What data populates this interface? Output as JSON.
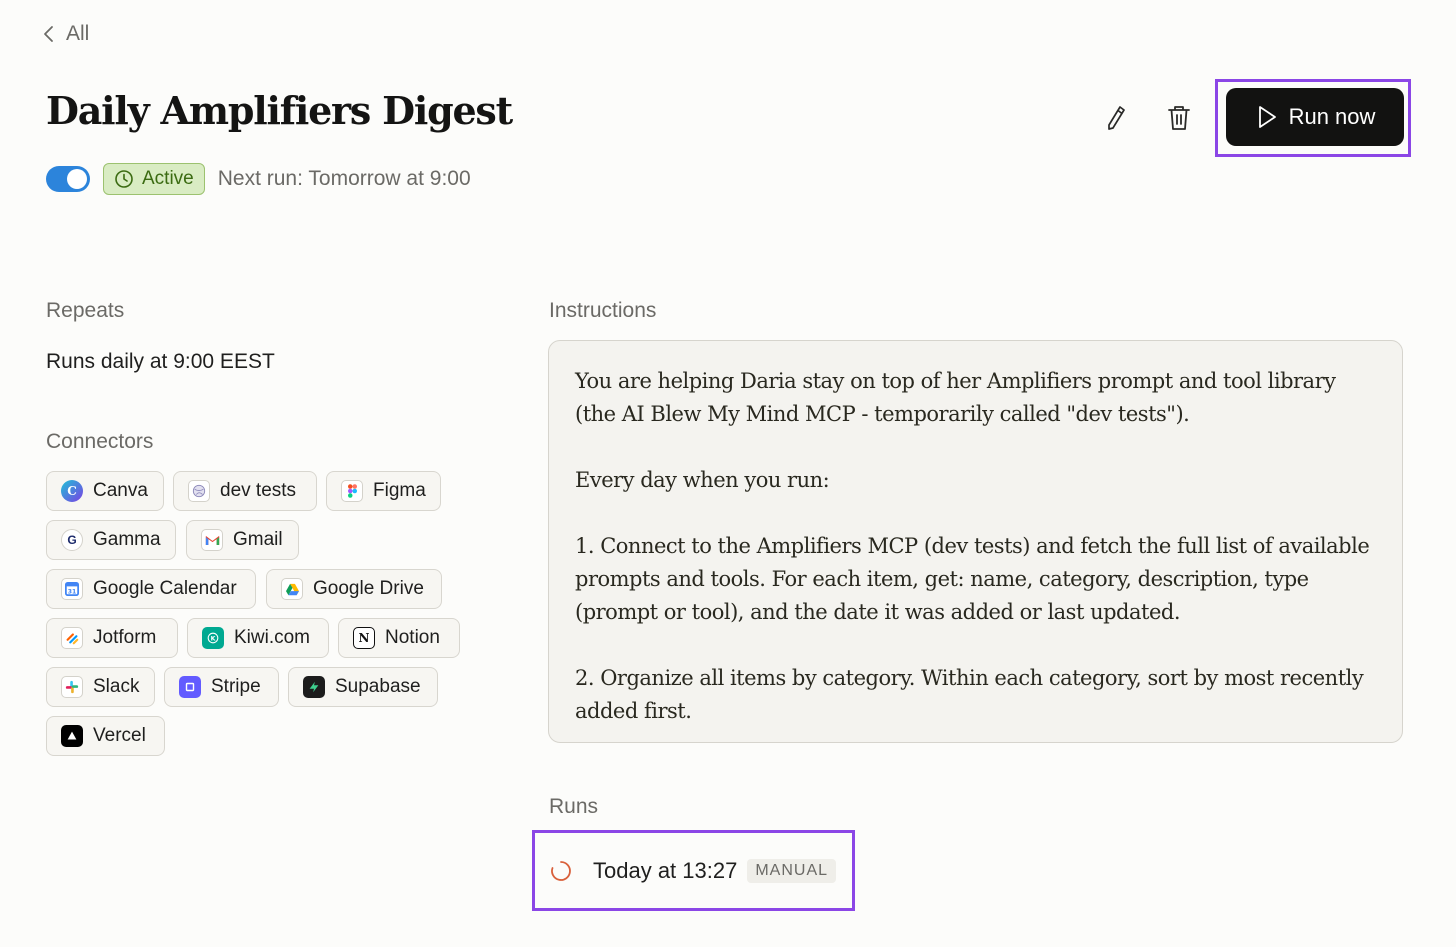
{
  "nav": {
    "back_label": "All"
  },
  "header": {
    "title": "Daily Amplifiers Digest",
    "status_label": "Active",
    "next_run": "Next run: Tomorrow at 9:00",
    "run_now_label": "Run now",
    "toggle_on": true
  },
  "repeats": {
    "label": "Repeats",
    "value": "Runs daily at 9:00 EEST"
  },
  "connectors": {
    "label": "Connectors",
    "items": [
      {
        "label": "Canva",
        "icon": "canva-icon"
      },
      {
        "label": "dev tests",
        "icon": "globe-icon"
      },
      {
        "label": "Figma",
        "icon": "figma-icon"
      },
      {
        "label": "Gamma",
        "icon": "gamma-icon"
      },
      {
        "label": "Gmail",
        "icon": "gmail-icon"
      },
      {
        "label": "Google Calendar",
        "icon": "google-calendar-icon"
      },
      {
        "label": "Google Drive",
        "icon": "google-drive-icon"
      },
      {
        "label": "Jotform",
        "icon": "jotform-icon"
      },
      {
        "label": "Kiwi.com",
        "icon": "kiwi-icon"
      },
      {
        "label": "Notion",
        "icon": "notion-icon"
      },
      {
        "label": "Slack",
        "icon": "slack-icon"
      },
      {
        "label": "Stripe",
        "icon": "stripe-icon"
      },
      {
        "label": "Supabase",
        "icon": "supabase-icon"
      },
      {
        "label": "Vercel",
        "icon": "vercel-icon"
      }
    ]
  },
  "instructions": {
    "label": "Instructions",
    "paragraphs": [
      "You are helping Daria stay on top of her Amplifiers prompt and tool library (the AI Blew My Mind MCP - temporarily called \"dev tests\").",
      "Every day when you run:",
      "1. Connect to the Amplifiers MCP (dev tests) and fetch the full list of available prompts and tools. For each item, get: name, category, description, type (prompt or tool), and the date it was added or last updated.",
      "2. Organize all items by category. Within each category, sort by most recently added first."
    ]
  },
  "runs": {
    "label": "Runs",
    "items": [
      {
        "time": "Today at 13:27",
        "tag": "MANUAL",
        "status": "running"
      }
    ]
  },
  "colors": {
    "accent_blue": "#2c84db",
    "active_green": "#3b6b12",
    "highlight_purple": "#8b46e6",
    "run_spinner": "#d9603b"
  }
}
